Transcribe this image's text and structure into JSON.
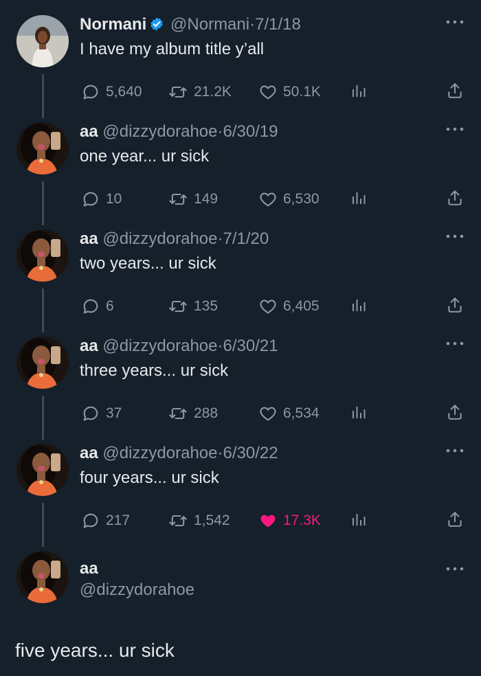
{
  "tweets": [
    {
      "name": "Normani",
      "verified": true,
      "handle": "@Normani",
      "date": "7/1/18",
      "text": "I have my album title y’all",
      "replies": "5,640",
      "retweets": "21.2K",
      "likes": "50.1K",
      "liked": false
    },
    {
      "name": "aa",
      "verified": false,
      "handle": "@dizzydorahoe",
      "date": "6/30/19",
      "text": "one year... ur sick",
      "replies": "10",
      "retweets": "149",
      "likes": "6,530",
      "liked": false
    },
    {
      "name": "aa",
      "verified": false,
      "handle": "@dizzydorahoe",
      "date": "7/1/20",
      "text": "two years... ur sick",
      "replies": "6",
      "retweets": "135",
      "likes": "6,405",
      "liked": false
    },
    {
      "name": "aa",
      "verified": false,
      "handle": "@dizzydorahoe",
      "date": "6/30/21",
      "text": "three years... ur sick",
      "replies": "37",
      "retweets": "288",
      "likes": "6,534",
      "liked": false
    },
    {
      "name": "aa",
      "verified": false,
      "handle": "@dizzydorahoe",
      "date": "6/30/22",
      "text": "four years... ur sick",
      "replies": "217",
      "retweets": "1,542",
      "likes": "17.3K",
      "liked": true
    }
  ],
  "focused": {
    "name": "aa",
    "handle": "@dizzydorahoe",
    "text": "five years... ur sick"
  },
  "separator": "·",
  "icons": {
    "reply": "reply-icon",
    "retweet": "retweet-icon",
    "like": "heart-icon",
    "stats": "analytics-icon",
    "share": "share-icon",
    "more": "more-dots-icon",
    "verified": "verified-badge-icon"
  },
  "colors": {
    "background": "#15202b",
    "text": "#e7e9ea",
    "muted": "#8b98a5",
    "like": "#f91880",
    "verified": "#1d9bf0",
    "thread_line": "#3e4a55"
  }
}
